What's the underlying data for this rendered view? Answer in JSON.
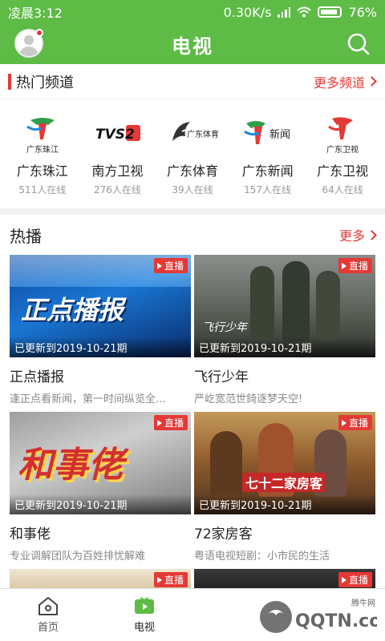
{
  "statusbar": {
    "time": "凌晨3:12",
    "speed": "0.30K/s",
    "battery": "76%"
  },
  "appbar": {
    "title": "电视"
  },
  "hot_channels": {
    "title": "热门频道",
    "more": "更多频道",
    "channels": [
      {
        "name": "广东珠江",
        "online": "511人在线",
        "logo_text": "广东珠江"
      },
      {
        "name": "南方卫视",
        "online": "276人在线",
        "logo_text": "TVS2"
      },
      {
        "name": "广东体育",
        "online": "39人在线",
        "logo_text": "广东体育"
      },
      {
        "name": "广东新闻",
        "online": "157人在线",
        "logo_text": "新闻"
      },
      {
        "name": "广东卫视",
        "online": "64人在线",
        "logo_text": "广东卫视"
      }
    ]
  },
  "hot_play": {
    "title": "热播",
    "more": "更多",
    "live_label": "直播",
    "items": [
      {
        "title": "正点播报",
        "desc": "逢正点看新闻，第一时间纵览全...",
        "updated": "已更新到2019-10-21期",
        "thumb_text": "正点播报"
      },
      {
        "title": "飞行少年",
        "desc": "严屹宽范世錡逐梦天空!",
        "updated": "已更新到2019-10-21期",
        "thumb_text": "飞行少年"
      },
      {
        "title": "和事佬",
        "desc": "专业调解团队为百姓排忧解难",
        "updated": "已更新到2019-10-21期",
        "thumb_text": "和事佬"
      },
      {
        "title": "72家房客",
        "desc": "粤语电视短剧：小市民的生活",
        "updated": "已更新到2019-10-21期",
        "thumb_text": "七十二家房客"
      }
    ]
  },
  "tabbar": {
    "tabs": [
      {
        "label": "首页"
      },
      {
        "label": "电视"
      },
      {
        "label": ""
      },
      {
        "label": ""
      }
    ]
  },
  "watermark": {
    "text": "QQTN.com",
    "sub": "腾牛网"
  },
  "colors": {
    "brand": "#5dbb46",
    "accent": "#e53935"
  }
}
